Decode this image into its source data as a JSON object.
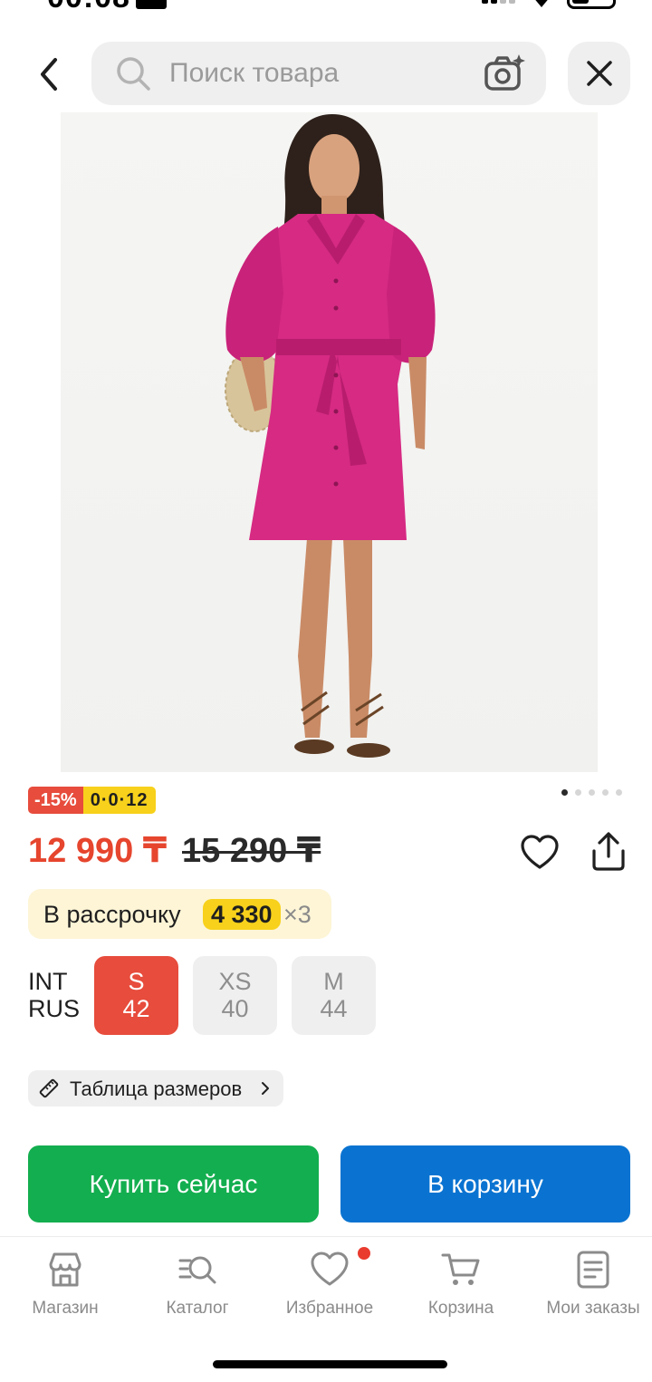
{
  "status_bar": {
    "time": "00:08"
  },
  "header": {
    "search_placeholder": "Поиск товара",
    "icons": [
      "back-arrow-icon",
      "search-icon",
      "camera-icon",
      "close-icon"
    ]
  },
  "product": {
    "image_description_icon": "product-photo",
    "discount_badge": "-15%",
    "installment_badge": "0·0·12",
    "gallery": {
      "total": 5,
      "active": 1
    },
    "price_current": "12 990 ₸",
    "price_old": "15 290 ₸",
    "installment": {
      "label": "В рассрочку",
      "amount": "4 330",
      "times": "×3"
    },
    "size_systems": {
      "int": "INT",
      "rus": "RUS"
    },
    "sizes": [
      {
        "int": "S",
        "rus": "42",
        "selected": true
      },
      {
        "int": "XS",
        "rus": "40",
        "selected": false
      },
      {
        "int": "M",
        "rus": "44",
        "selected": false
      }
    ],
    "size_chart_label": "Таблица размеров"
  },
  "actions": {
    "buy_now": "Купить сейчас",
    "add_to_cart": "В корзину"
  },
  "bottom_nav": {
    "items": [
      {
        "label": "Магазин",
        "icon": "store-icon"
      },
      {
        "label": "Каталог",
        "icon": "catalog-search-icon"
      },
      {
        "label": "Избранное",
        "icon": "heart-icon"
      },
      {
        "label": "Корзина",
        "icon": "cart-icon"
      },
      {
        "label": "Мои заказы",
        "icon": "orders-icon"
      }
    ],
    "favorites_has_notification": true
  },
  "colors": {
    "accent_red": "#e74c3c",
    "price_red": "#e6452e",
    "badge_yellow": "#f7d11b",
    "buy_green": "#13ae4f",
    "cart_blue": "#0a73d1"
  }
}
